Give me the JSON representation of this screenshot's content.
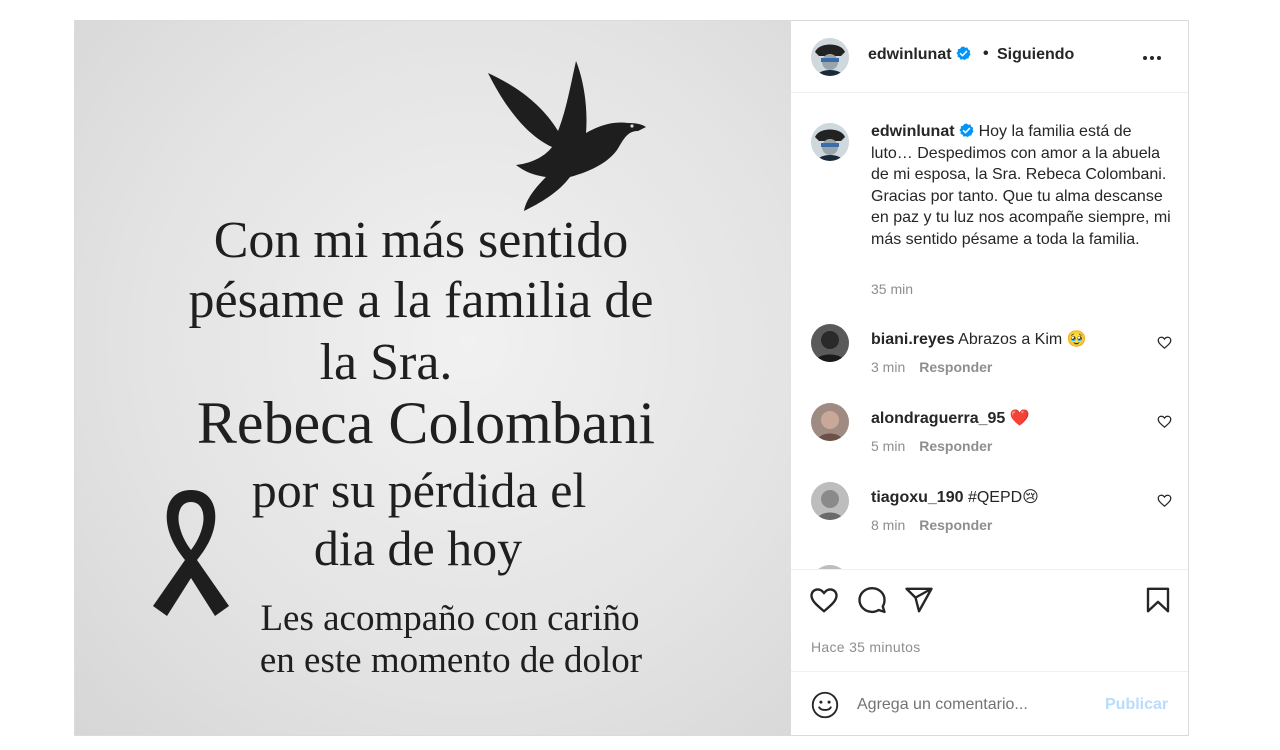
{
  "image": {
    "lines": [
      "Con mi más sentido",
      "pésame a la familia de",
      "la Sra.",
      "Rebeca Colombani",
      "por su pérdida el",
      "dia de hoy",
      "Les acompaño con cariño",
      "en este momento de dolor"
    ]
  },
  "header": {
    "username": "edwinlunat",
    "separator": "•",
    "follow_label": "Siguiendo"
  },
  "caption": {
    "username": "edwinlunat",
    "text": "Hoy la familia está de luto… Despedimos con amor a la abuela de mi esposa, la Sra. Rebeca Colombani. Gracias por tanto. Que tu alma descanse en paz y tu luz nos acompañe siempre, mi más sentido pésame a toda la familia.",
    "time": "35 min"
  },
  "comments": [
    {
      "username": "biani.reyes",
      "text": "Abrazos a Kim 🥹",
      "time": "3 min",
      "reply": "Responder"
    },
    {
      "username": "alondraguerra_95",
      "text": "❤️",
      "time": "5 min",
      "reply": "Responder"
    },
    {
      "username": "tiagoxu_190",
      "text": "#QEPD😢",
      "time": "8 min",
      "reply": "Responder"
    }
  ],
  "footer": {
    "posted": "Hace 35 minutos",
    "comment_placeholder": "Agrega un comentario...",
    "publish_label": "Publicar"
  },
  "colors": {
    "verified": "#0095f6",
    "publish_disabled": "#b9dcfb",
    "muted_text": "#8e8e8e"
  },
  "icons": [
    "dove-icon",
    "ribbon-icon",
    "verified-icon",
    "more-icon",
    "heart-icon",
    "comment-icon",
    "share-icon",
    "bookmark-icon",
    "emoji-icon"
  ]
}
